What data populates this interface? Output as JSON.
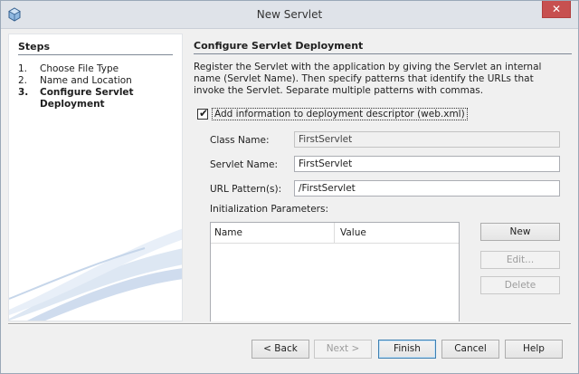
{
  "window": {
    "title": "New Servlet"
  },
  "steps": {
    "title": "Steps",
    "items": [
      {
        "num": "1.",
        "label": "Choose File Type",
        "current": false
      },
      {
        "num": "2.",
        "label": "Name and Location",
        "current": false
      },
      {
        "num": "3.",
        "label": "Configure Servlet Deployment",
        "current": true
      }
    ]
  },
  "content": {
    "title": "Configure Servlet Deployment",
    "description": "Register the Servlet with the application by giving the Servlet an internal name (Servlet Name). Then specify patterns that identify the URLs that invoke the Servlet. Separate multiple patterns with commas.",
    "checkbox": {
      "label": "Add information to deployment descriptor (web.xml)",
      "checked": true
    },
    "class_name": {
      "label": "Class Name:",
      "value": "FirstServlet"
    },
    "servlet_name": {
      "label": "Servlet Name:",
      "value": "FirstServlet"
    },
    "url_pattern": {
      "label": "URL Pattern(s):",
      "value": "/FirstServlet"
    },
    "params": {
      "label": "Initialization Parameters:",
      "columns": [
        "Name",
        "Value"
      ]
    },
    "side_buttons": {
      "new": "New",
      "edit": "Edit...",
      "delete": "Delete"
    }
  },
  "buttons": {
    "back": "< Back",
    "next": "Next >",
    "finish": "Finish",
    "cancel": "Cancel",
    "help": "Help"
  },
  "colors": {
    "close": "#c75050",
    "titlebar": "#dfe3e9",
    "accent": "#3c7fb1"
  }
}
